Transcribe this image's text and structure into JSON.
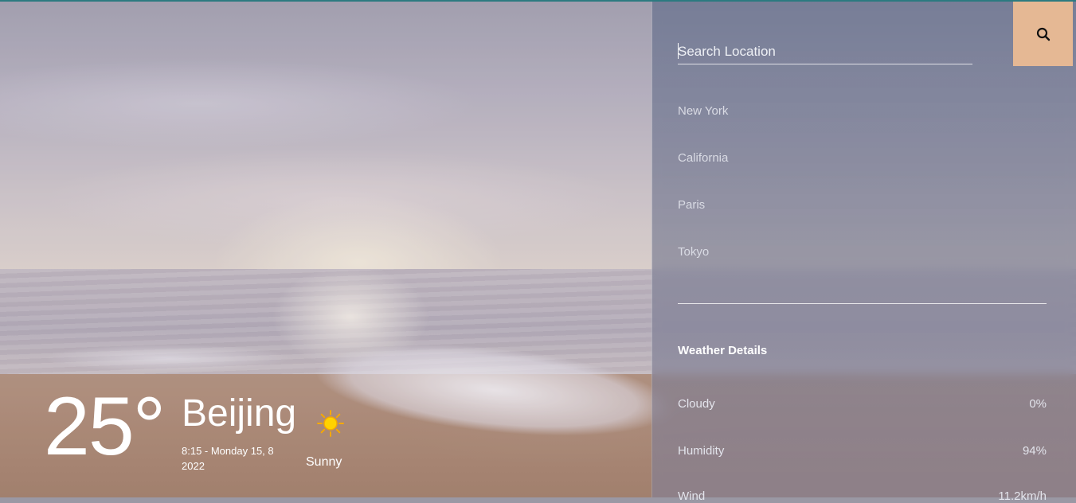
{
  "weather": {
    "temperature": "25°",
    "city": "Beijing",
    "datetime": "8:15 - Monday 15, 8 2022",
    "condition": "Sunny",
    "condition_icon": "sun-icon"
  },
  "search": {
    "placeholder": "Search Location",
    "button_icon": "search-icon",
    "button_color": "#e5b894"
  },
  "locations": [
    "New York",
    "California",
    "Paris",
    "Tokyo"
  ],
  "details": {
    "title": "Weather Details",
    "rows": [
      {
        "label": "Cloudy",
        "value": "0%"
      },
      {
        "label": "Humidity",
        "value": "94%"
      },
      {
        "label": "Wind",
        "value": "11.2km/h"
      }
    ]
  }
}
